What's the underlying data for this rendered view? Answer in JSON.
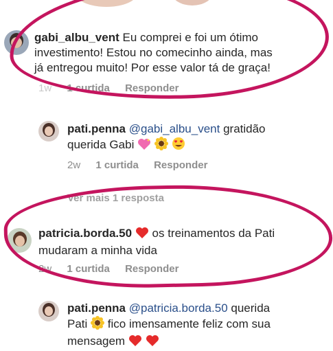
{
  "comments": [
    {
      "username": "gabi_albu_vent",
      "text": "Eu comprei e foi um ótimo investimento! Estou no comecinho ainda, mas já entregou muito! Por esse valor tá de graça!",
      "line1_rest": "Eu comprei e foi um ótimo",
      "line2": "investimento! Estou no comecinho ainda, mas",
      "line3": "já entregou muito! Por esse valor tá de graça!",
      "time": "1w",
      "likes": "1 curtida",
      "reply": "Responder"
    },
    {
      "username": "pati.penna",
      "mention": "@gabi_albu_vent",
      "line1_rest": "gratidão",
      "line2": "querida Gabi",
      "time": "2w",
      "likes": "1 curtida",
      "reply": "Responder"
    },
    {
      "view_more": "Ver mais 1 resposta"
    },
    {
      "username": "patricia.borda.50",
      "line1_rest": "os treinamentos da Pati",
      "line2": "mudaram a minha vida",
      "time": "2w",
      "likes": "1 curtida",
      "reply": "Responder"
    },
    {
      "username": "pati.penna",
      "mention": "@patricia.borda.50",
      "line1_rest": "querida",
      "line2a": "Pati",
      "line2b": "fico imensamente feliz com sua",
      "line3": "mensagem"
    }
  ],
  "colors": {
    "highlight": "#c4155e",
    "mention": "#2a4f8a",
    "meta": "#8e8e8e"
  }
}
